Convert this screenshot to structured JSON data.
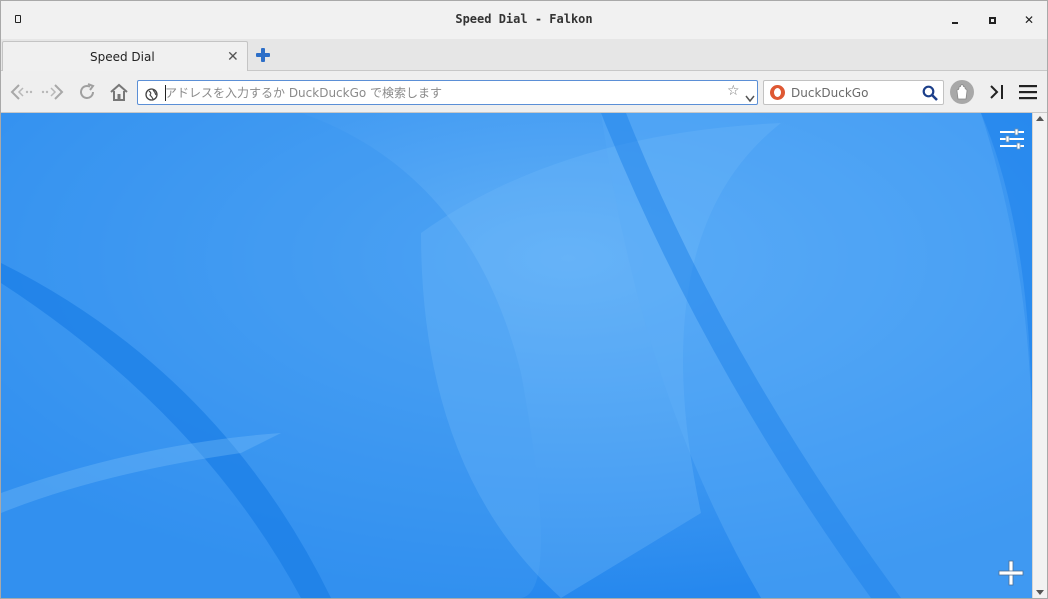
{
  "window": {
    "title": "Speed Dial - Falkon",
    "controls": [
      "minimize",
      "maximize",
      "close"
    ]
  },
  "tabs": [
    {
      "label": "Speed Dial",
      "active": true
    }
  ],
  "toolbar": {
    "icons": [
      "back-icon",
      "forward-icon",
      "reload-icon",
      "home-icon"
    ],
    "address_placeholder": "アドレスを入力するか DuckDuckGo で検索します",
    "address_value": "",
    "search_engine": "DuckDuckGo",
    "search_placeholder": "DuckDuckGo",
    "search_value": ""
  },
  "speed_dial": {
    "settings_icon": "sliders-icon",
    "add_icon": "plus-icon"
  },
  "colors": {
    "wallpaper": "#2f8ef0",
    "accent": "#2d6fc8",
    "duckduckgo": "#de5833"
  }
}
